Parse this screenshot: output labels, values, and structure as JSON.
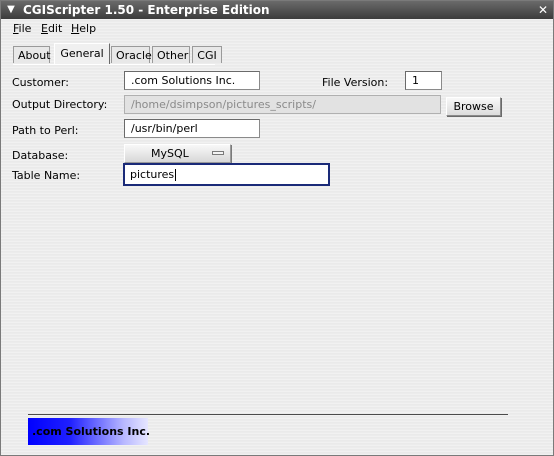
{
  "window": {
    "title": "CGIScripter 1.50 - Enterprise Edition",
    "menu_icon": "chevron-down-icon",
    "close_icon": "close-icon"
  },
  "menubar": {
    "file": {
      "mnemonic": "F",
      "rest": "ile"
    },
    "edit": {
      "mnemonic": "E",
      "rest": "dit"
    },
    "help": {
      "mnemonic": "H",
      "rest": "elp"
    }
  },
  "tabs": [
    {
      "label": "About"
    },
    {
      "label": "General",
      "active": true
    },
    {
      "label": "Oracle"
    },
    {
      "label": "Other"
    },
    {
      "label": "CGI"
    }
  ],
  "form": {
    "customer": {
      "label": "Customer:",
      "value": ".com Solutions Inc."
    },
    "file_version": {
      "label": "File Version:",
      "value": "1"
    },
    "output_directory": {
      "label": "Output Directory:",
      "value": "/home/dsimpson/pictures_scripts/"
    },
    "browse_label": "Browse",
    "path_to_perl": {
      "label": "Path to Perl:",
      "value": "/usr/bin/perl"
    },
    "database": {
      "label": "Database:",
      "value": "MySQL"
    },
    "table_name": {
      "label": "Table Name:",
      "value": "pictures"
    }
  },
  "footer": {
    "logo_text": ".com Solutions Inc."
  },
  "colors": {
    "titlebar": "#3c3c3c",
    "focus_border": "#1a2a78",
    "logo_blue": "#0000ff"
  }
}
